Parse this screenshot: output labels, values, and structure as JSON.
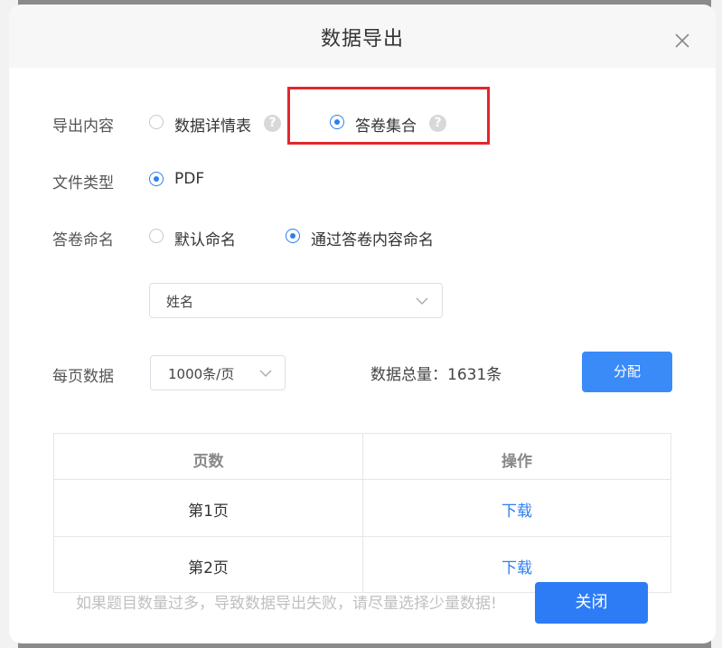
{
  "dialog": {
    "title": "数据导出",
    "close_icon": "close-icon"
  },
  "export_content": {
    "label": "导出内容",
    "options": [
      {
        "label": "数据详情表",
        "selected": false,
        "help_icon": "question-icon"
      },
      {
        "label": "答卷集合",
        "selected": true,
        "help_icon": "question-icon"
      }
    ]
  },
  "file_type": {
    "label": "文件类型",
    "options": [
      {
        "label": "PDF",
        "selected": true
      }
    ]
  },
  "naming": {
    "label": "答卷命名",
    "options": [
      {
        "label": "默认命名",
        "selected": false
      },
      {
        "label": "通过答卷内容命名",
        "selected": true
      }
    ],
    "field_select": {
      "value": "姓名",
      "icon": "chevron-down-icon"
    }
  },
  "per_page": {
    "label": "每页数据",
    "select": {
      "value": "1000条/页",
      "icon": "chevron-down-icon"
    },
    "total_label": "数据总量：1631条",
    "distribute_button": "分配"
  },
  "table": {
    "headers": [
      "页数",
      "操作"
    ],
    "rows": [
      {
        "page": "第1页",
        "action": "下载"
      },
      {
        "page": "第2页",
        "action": "下载"
      }
    ]
  },
  "footer": {
    "note": "如果题目数量过多，导致数据导出失败，请尽量选择少量数据!",
    "close_button": "关闭"
  },
  "colors": {
    "accent": "#2e7ef0",
    "highlight": "#e3262c"
  }
}
